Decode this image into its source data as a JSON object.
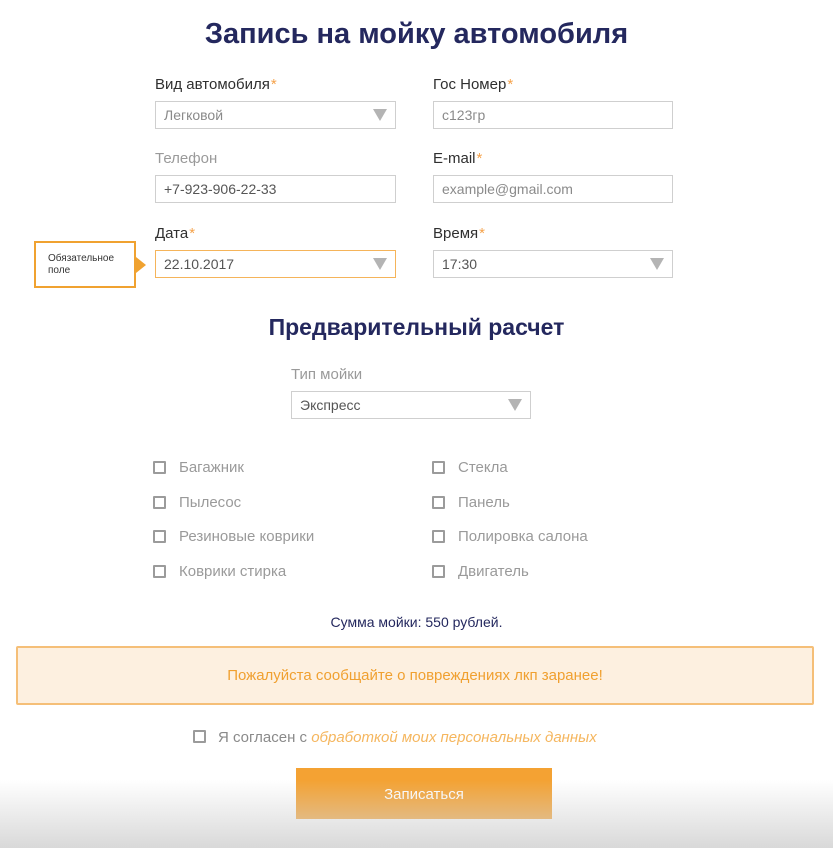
{
  "title": "Запись на мойку автомобиля",
  "fields": {
    "car_type": {
      "label": "Вид автомобиля",
      "required": "*",
      "value": "Легковой"
    },
    "plate": {
      "label": "Гос Номер",
      "required": "*",
      "placeholder": "с123гр"
    },
    "phone": {
      "label": "Телефон",
      "value": "+7-923-906-22-33"
    },
    "email": {
      "label": "E-mail",
      "required": "*",
      "placeholder": "example@gmail.com"
    },
    "date": {
      "label": "Дата",
      "required": "*",
      "value": "22.10.2017"
    },
    "time": {
      "label": "Время",
      "required": "*",
      "value": "17:30"
    }
  },
  "tooltip": {
    "text": "Обязательное поле"
  },
  "estimate": {
    "heading": "Предварительный расчет",
    "wash_type_label": "Тип мойки",
    "wash_type_value": "Экспресс"
  },
  "options": {
    "left": [
      "Багажник",
      "Пылесос",
      "Резиновые коврики",
      "Коврики стирка"
    ],
    "right": [
      "Стекла",
      "Панель",
      "Полировка салона",
      "Двигатель"
    ]
  },
  "sum_text": "Сумма мойки: 550 рублей.",
  "notice": "Пожалуйста сообщайте о повреждениях лкп заранее!",
  "consent": {
    "prefix": "Я согласен с",
    "link": "обработкой моих персональных данных"
  },
  "submit_label": "Записаться",
  "colors": {
    "accent": "#f4a233",
    "heading": "#24285e",
    "notice_bg": "#fdf0e0"
  }
}
